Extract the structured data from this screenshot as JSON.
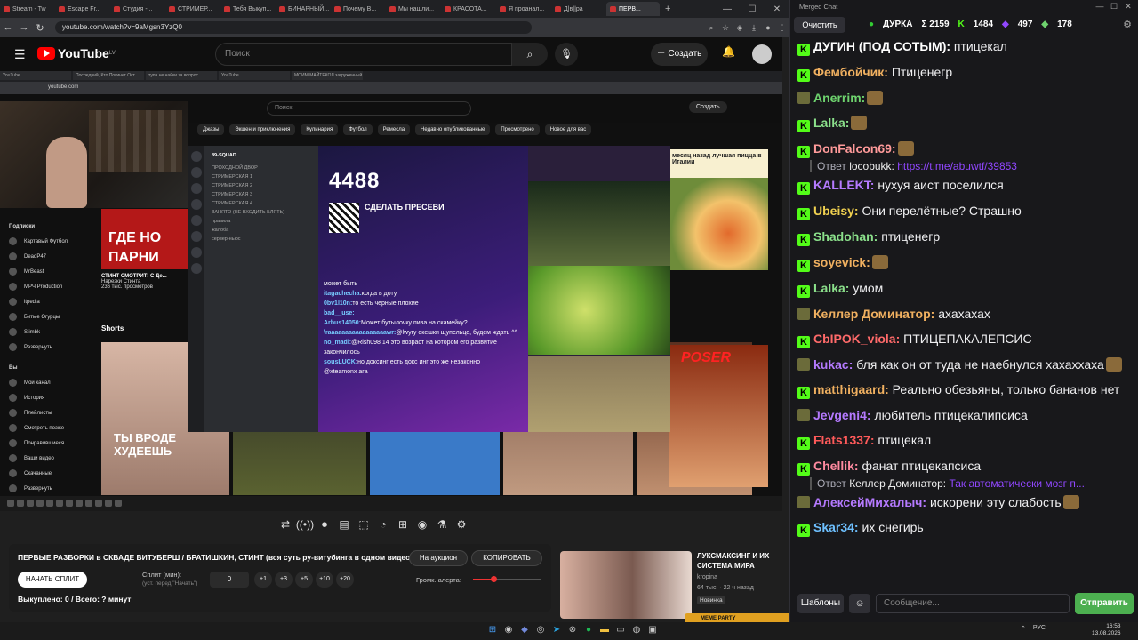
{
  "browser": {
    "tabs": [
      "Stream - Tw",
      "Escape Fr...",
      "Студия -...",
      "СТРИМЕР...",
      "Тебя Выкуп...",
      "БИНАРНЫЙ...",
      "Почему В...",
      "Мы нашли...",
      "КРАСОТА...",
      "Я проанал...",
      "Д|в||ра",
      "ПЕРВ..."
    ],
    "url": "youtube.com/watch?v=9aMgsn3YzQ0"
  },
  "youtube": {
    "logo": "YouTube",
    "region": "LV",
    "search_placeholder": "Поиск",
    "create_label": "Создать"
  },
  "stream": {
    "inner_tabs": [
      "YouTube",
      "Последний, Кто Покинет Ост...",
      "тупа не найки за вопрос",
      "YouTube",
      "МОИМ МАЙТЕКОЛ загруженный..."
    ],
    "inner_url": "youtube.com",
    "inner_search": "Поиск",
    "inner_create": "Создать",
    "chips": [
      "Джазы",
      "Экшен и приключения",
      "Кулинария",
      "Футбол",
      "Ремесла",
      "Недавно опубликованные",
      "Просмотрено",
      "Новое для вас"
    ],
    "subs_header": "Подписки",
    "subs": [
      "Картавый Футбол",
      "DeadP47",
      "MrBeast",
      "МРЧ Production",
      "itpedia",
      "Битые Огурцы",
      "Slimbk",
      "Развернуть"
    ],
    "you_header": "Вы",
    "you_items": [
      "Мой канал",
      "История",
      "Плейлисты",
      "Смотреть позже",
      "Понравившиеся",
      "Ваши видео",
      "Скачанные",
      "Развернуть"
    ],
    "thumb1_text": "ГДЕ НО ПАРНИ",
    "video1_title": "СТИНТ СМОТРИТ: С Де...",
    "video1_channel": "Нарезки Стинта",
    "video1_meta": "236 тыс. просмотров",
    "shorts_label": "Shorts",
    "short1_text": "ТЫ ВРОДЕ ХУДЕЕШЬ",
    "pizza_caption": "месяц назад лучшая пицца в Италии",
    "poser_text": "POSER",
    "discord": {
      "server_name": "89-SQUAD",
      "channels": [
        "ПРОХОДНОЙ ДВОР",
        "СТРИМЕРСКАЯ 1",
        "СТРИМЕРСКАЯ 2",
        "СТРИМЕРСКАЯ 3",
        "СТРИМЕРСКАЯ 4",
        "ЗАНЯТО (НЕ ВХОДИТЬ БЛЯТЬ)",
        "правила",
        "жалоба",
        "сервер-ньюс"
      ],
      "big_number": "4488",
      "present_text": "СДЕЛАТЬ ПРЕСЕВИ",
      "messages": [
        {
          "user": "",
          "text": "может быть"
        },
        {
          "user": "itagachecha:",
          "text": "когда в доту"
        },
        {
          "user": "0bv1l10n:",
          "text": "то есть черные плохие"
        },
        {
          "user": "bad__use:",
          "text": ""
        },
        {
          "user": "Arbus14050:",
          "text": "Может бутылочку пива на скамейку?"
        },
        {
          "user": "\\raaaaaaaaaaaaaaaaawr:",
          "text": "@lwyry окешки щупельце, будем ждать ^^"
        },
        {
          "user": "no_madi:",
          "text": "@Rish098 14 это возраст на котором его развитие закончилось"
        },
        {
          "user": "sousLUCK:",
          "text": "но доксинг есть докс инг это же незаконно"
        },
        {
          "user": "",
          "text": "@xteamonx ага"
        }
      ]
    }
  },
  "toolbar_icons": [
    "repeat-icon",
    "broadcast-icon",
    "camera-record-icon",
    "clapper-icon",
    "crop-icon",
    "speed-icon",
    "add-icon",
    "screenshot-icon",
    "flask-icon",
    "gear-icon"
  ],
  "panel": {
    "title": "ПЕРВЫЕ РАЗБОРКИ в СКВАДЕ ВИТУБЕРШ / БРАТИШКИН, СТИНТ (вся суть ру-витубинга в одном видео)",
    "auction_label": "На аукцион",
    "copy_label": "КОПИРОВАТЬ",
    "start_split_label": "НАЧАТЬ СПЛИТ",
    "split_label": "Сплит (мин):",
    "split_sub": "(уст. перед \"Начать\")",
    "split_value": "0",
    "increments": [
      "+1",
      "+3",
      "+5",
      "+10",
      "+20"
    ],
    "volume_label": "Громк. алерта:",
    "volume_level": 0.3,
    "bought_text": "Выкуплено: 0 / Всего: ? минут"
  },
  "card": {
    "title": "ЛУКСМАКСИНГ И ИХ СИСТЕМА МИРА",
    "channel": "kropina",
    "meta": "64 тыс. · 22 ч назад",
    "badge": "Новинка",
    "meme_bar": "MEME PARTY"
  },
  "chat": {
    "window_title": "Merged Chat",
    "clear_label": "Очистить",
    "streamer": "ДУРКА",
    "stats": [
      "Σ 2159",
      "1484",
      "497",
      "178"
    ],
    "messages": [
      {
        "src": "k",
        "user": "ДУГИН (ПОД СОТЫМ):",
        "color": "#ffffff",
        "text": " птицекал"
      },
      {
        "src": "k",
        "user": "Фембойчик:",
        "color": "#f0b060",
        "text": " Птиценегр"
      },
      {
        "src": "tw",
        "user": "Anerrim:",
        "color": "#6ed36e",
        "text": "",
        "emote": true
      },
      {
        "src": "k",
        "user": "Lalka:",
        "color": "#8be08b",
        "text": "",
        "emote": true
      },
      {
        "src": "k",
        "user": "DonFalcon69:",
        "color": "#ff9a9a",
        "text": "",
        "emote": true
      },
      {
        "src": "reply",
        "user": "locobukk:",
        "text": "https://t.me/abuwtf/39853"
      },
      {
        "src": "k",
        "user": "KALLEKT:",
        "color": "#b57aff",
        "text": " нухуя аист поселился"
      },
      {
        "src": "k",
        "user": "Ubeisy:",
        "color": "#f0d050",
        "text": " Они перелётные? Страшно"
      },
      {
        "src": "k",
        "user": "Shadohan:",
        "color": "#8be08b",
        "text": " птиценегр"
      },
      {
        "src": "k",
        "user": "soyevick:",
        "color": "#f0b060",
        "text": "",
        "emote": true
      },
      {
        "src": "k",
        "user": "Lalka:",
        "color": "#8be08b",
        "text": " умом"
      },
      {
        "src": "tw",
        "user": "Келлер Доминатор:",
        "color": "#f0b060",
        "text": " ахахахах"
      },
      {
        "src": "k",
        "user": "CbIPOK_viola:",
        "color": "#ff6a6a",
        "text": " ПТИЦЕПАКАЛЕПСИС"
      },
      {
        "src": "tw",
        "user": "kukac:",
        "color": "#b57aff",
        "text": " бля как он от туда не наебнулся хахаххаха",
        "emote": true
      },
      {
        "src": "k",
        "user": "matthigaard:",
        "color": "#f0b060",
        "text": " Реально обезьяны, только бананов нет"
      },
      {
        "src": "tw",
        "user": "Jevgeni4:",
        "color": "#b57aff",
        "text": " любитель птицекалипсиса"
      },
      {
        "src": "k",
        "user": "Flats1337:",
        "color": "#ff5a5a",
        "text": " птицекал"
      },
      {
        "src": "k",
        "user": "Chellik:",
        "color": "#ff8aa0",
        "text": " фанат птицекапсиса"
      },
      {
        "src": "reply",
        "user": "Келлер Доминатор:",
        "text": "Так автоматически мозг п..."
      },
      {
        "src": "tw",
        "user": "АлексейМихалыч:",
        "color": "#b57aff",
        "text": " искорени эту слабость",
        "emote": true
      },
      {
        "src": "k",
        "user": "Skar34:",
        "color": "#6ec0ff",
        "text": " их снегирь"
      }
    ],
    "reply_prefix": "Ответ",
    "templates_label": "Шаблоны",
    "input_placeholder": "Сообщение...",
    "send_label": "Отправить"
  },
  "taskbar": {
    "lang": "РУС",
    "time": "16:53",
    "date": "13.08.2026"
  },
  "colors": {
    "kick_green": "#53fc18",
    "yt_red": "#ff0000",
    "send_green": "#4caf50"
  }
}
